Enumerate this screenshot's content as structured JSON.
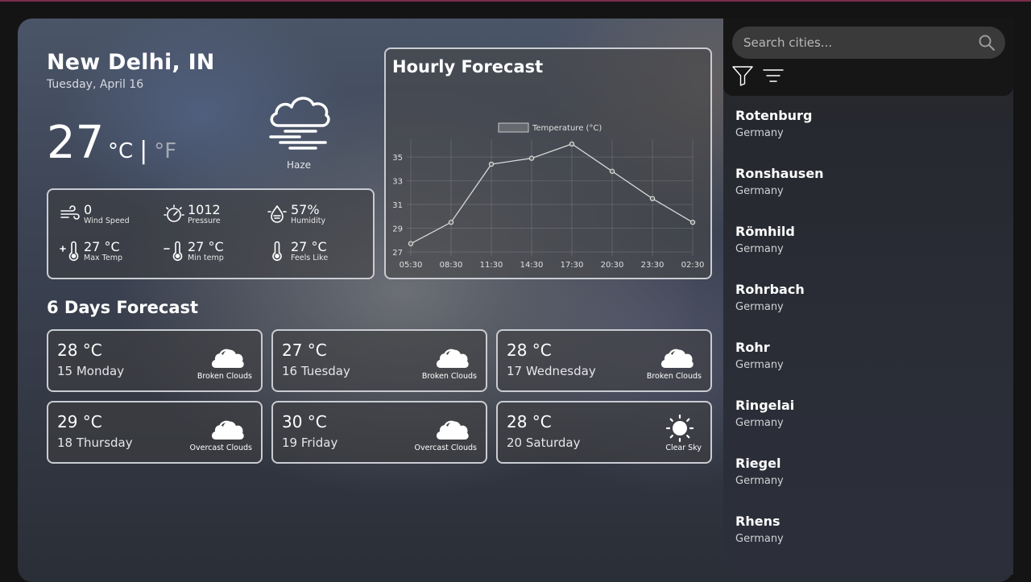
{
  "location": {
    "city": "New Delhi, IN",
    "date": "Tuesday, April 16"
  },
  "current": {
    "temp": "27",
    "unit_c": "°C",
    "unit_sep": "|",
    "unit_f": "°F",
    "condition": "Haze",
    "condition_icon": "haze-icon"
  },
  "stats": [
    {
      "value": "0",
      "label": "Wind Speed",
      "icon": "wind-icon"
    },
    {
      "value": "1012",
      "label": "Pressure",
      "icon": "pressure-icon"
    },
    {
      "value": "57%",
      "label": "Humidity",
      "icon": "humidity-icon"
    },
    {
      "value": "27 °C",
      "label": "Max Temp",
      "icon": "thermometer-plus-icon"
    },
    {
      "value": "27 °C",
      "label": "Min temp",
      "icon": "thermometer-minus-icon"
    },
    {
      "value": "27 °C",
      "label": "Feels Like",
      "icon": "thermometer-icon"
    }
  ],
  "hourly": {
    "title": "Hourly Forecast"
  },
  "chart_data": {
    "type": "line",
    "title": "Hourly Forecast",
    "categories": [
      "05:30",
      "08:30",
      "11:30",
      "14:30",
      "17:30",
      "20:30",
      "23:30",
      "02:30"
    ],
    "series": [
      {
        "name": "Temperature (°C)",
        "values": [
          27.7,
          29.5,
          34.4,
          34.9,
          36.1,
          33.8,
          31.5,
          29.5
        ]
      }
    ],
    "ylim": [
      27,
      36.5
    ],
    "yticks": [
      27,
      29,
      31,
      33,
      35
    ],
    "grid": true,
    "legend": "top"
  },
  "forecast": {
    "title": "6 Days Forecast",
    "days": [
      {
        "temp": "28 °C",
        "day": "15 Monday",
        "desc": "Broken Clouds",
        "icon": "cloud-icon"
      },
      {
        "temp": "27 °C",
        "day": "16 Tuesday",
        "desc": "Broken Clouds",
        "icon": "cloud-icon"
      },
      {
        "temp": "28 °C",
        "day": "17 Wednesday",
        "desc": "Broken Clouds",
        "icon": "cloud-icon"
      },
      {
        "temp": "29 °C",
        "day": "18 Thursday",
        "desc": "Overcast Clouds",
        "icon": "cloud-icon"
      },
      {
        "temp": "30 °C",
        "day": "19 Friday",
        "desc": "Overcast Clouds",
        "icon": "cloud-icon"
      },
      {
        "temp": "28 °C",
        "day": "20 Saturday",
        "desc": "Clear Sky",
        "icon": "sun-icon"
      }
    ]
  },
  "search": {
    "placeholder": "Search cities..."
  },
  "cities": [
    {
      "name": "Rotenburg",
      "country": "Germany"
    },
    {
      "name": "Ronshausen",
      "country": "Germany"
    },
    {
      "name": "Römhild",
      "country": "Germany"
    },
    {
      "name": "Rohrbach",
      "country": "Germany"
    },
    {
      "name": "Rohr",
      "country": "Germany"
    },
    {
      "name": "Ringelai",
      "country": "Germany"
    },
    {
      "name": "Riegel",
      "country": "Germany"
    },
    {
      "name": "Rhens",
      "country": "Germany"
    }
  ],
  "colors": {
    "card_border": "#c9ccd2",
    "line": "#d8d8d8",
    "sidebar_head": "#161616"
  }
}
